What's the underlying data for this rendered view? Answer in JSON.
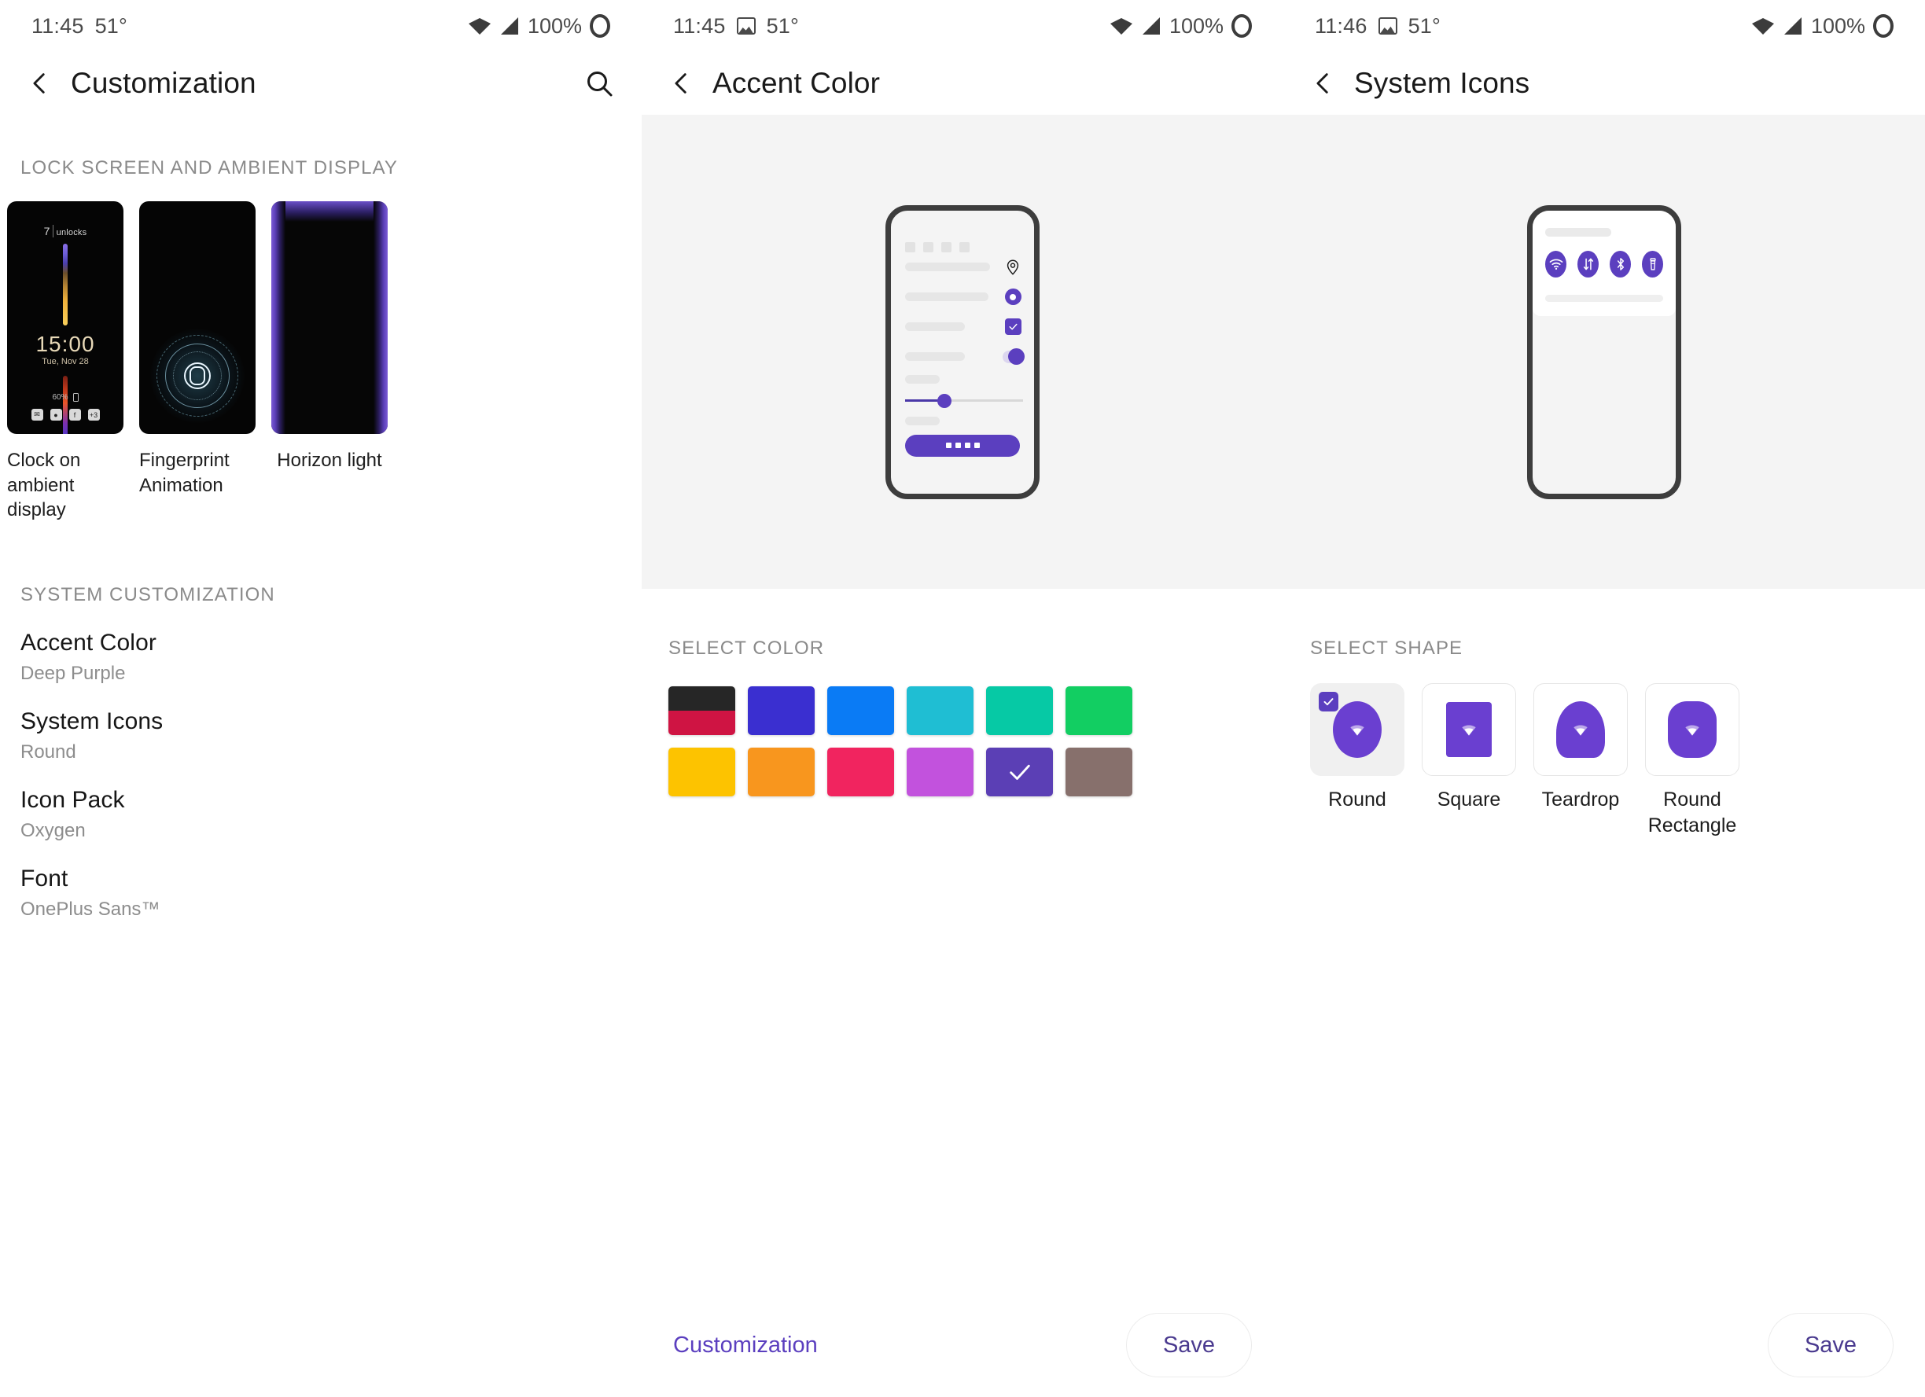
{
  "theme": {
    "accent_hex": "#5b3fbf",
    "preview_bg_hex": "#f4f4f4"
  },
  "panels": [
    {
      "statusbar": {
        "time": "11:45",
        "temperature": "51°",
        "battery": "100%",
        "image_icon": false
      },
      "appbar": {
        "title": "Customization",
        "has_search": true
      },
      "lock_section_label": "LOCK SCREEN AND AMBIENT DISPLAY",
      "thumbnails": [
        {
          "label": "Clock on ambient display",
          "art": "clock"
        },
        {
          "label": "Fingerprint Animation",
          "art": "fingerprint"
        },
        {
          "label": "Horizon light",
          "art": "horizon"
        }
      ],
      "lockscreen_art": {
        "unlocks_count": "7",
        "unlocks_word": "unlocks",
        "time": "15:00",
        "date": "Tue, Nov 28",
        "battery": "60%",
        "notif_more": "+3",
        "notif_icons": [
          "✉",
          "◉",
          "f"
        ]
      },
      "system_section_label": "SYSTEM CUSTOMIZATION",
      "settings": [
        {
          "title": "Accent Color",
          "value": "Deep Purple"
        },
        {
          "title": "System Icons",
          "value": "Round"
        },
        {
          "title": "Icon Pack",
          "value": "Oxygen"
        },
        {
          "title": "Font",
          "value": "OnePlus Sans™"
        }
      ]
    },
    {
      "statusbar": {
        "time": "11:45",
        "temperature": "51°",
        "battery": "100%",
        "image_icon": true
      },
      "appbar": {
        "title": "Accent Color",
        "has_search": false
      },
      "select_label": "SELECT COLOR",
      "swatches": [
        {
          "name": "black-crimson",
          "top": "#262626",
          "bottom": "#cf1443",
          "selected": false
        },
        {
          "name": "indigo",
          "top": "#3a2fd0",
          "bottom": "#3a2fd0",
          "selected": false
        },
        {
          "name": "blue",
          "top": "#0a7bf5",
          "bottom": "#0a7bf5",
          "selected": false
        },
        {
          "name": "cyan",
          "top": "#1fbed3",
          "bottom": "#1fbed3",
          "selected": false
        },
        {
          "name": "teal",
          "top": "#06c9a5",
          "bottom": "#06c9a5",
          "selected": false
        },
        {
          "name": "green",
          "top": "#12ce62",
          "bottom": "#12ce62",
          "selected": false
        },
        {
          "name": "yellow",
          "top": "#fdc300",
          "bottom": "#fdc300",
          "selected": false
        },
        {
          "name": "orange",
          "top": "#f8961e",
          "bottom": "#f8961e",
          "selected": false
        },
        {
          "name": "pink",
          "top": "#f1245f",
          "bottom": "#f1245f",
          "selected": false
        },
        {
          "name": "magenta",
          "top": "#c252dd",
          "bottom": "#c252dd",
          "selected": false
        },
        {
          "name": "deep-purple",
          "top": "#5b3fb5",
          "bottom": "#5b3fb5",
          "selected": true
        },
        {
          "name": "brown",
          "top": "#87706c",
          "bottom": "#87706c",
          "selected": false
        }
      ],
      "bottom": {
        "link": "Customization",
        "save_label": "Save"
      }
    },
    {
      "statusbar": {
        "time": "11:46",
        "temperature": "51°",
        "battery": "100%",
        "image_icon": true
      },
      "appbar": {
        "title": "System Icons",
        "has_search": false
      },
      "preview_icons": [
        "wifi-icon",
        "data-transfer-icon",
        "bluetooth-icon",
        "flashlight-icon"
      ],
      "select_label": "SELECT SHAPE",
      "shapes": [
        {
          "name": "Round",
          "selected": true
        },
        {
          "name": "Square",
          "selected": false
        },
        {
          "name": "Teardrop",
          "selected": false
        },
        {
          "name": "Round Rectangle",
          "selected": false
        }
      ],
      "bottom": {
        "save_label": "Save"
      }
    }
  ]
}
